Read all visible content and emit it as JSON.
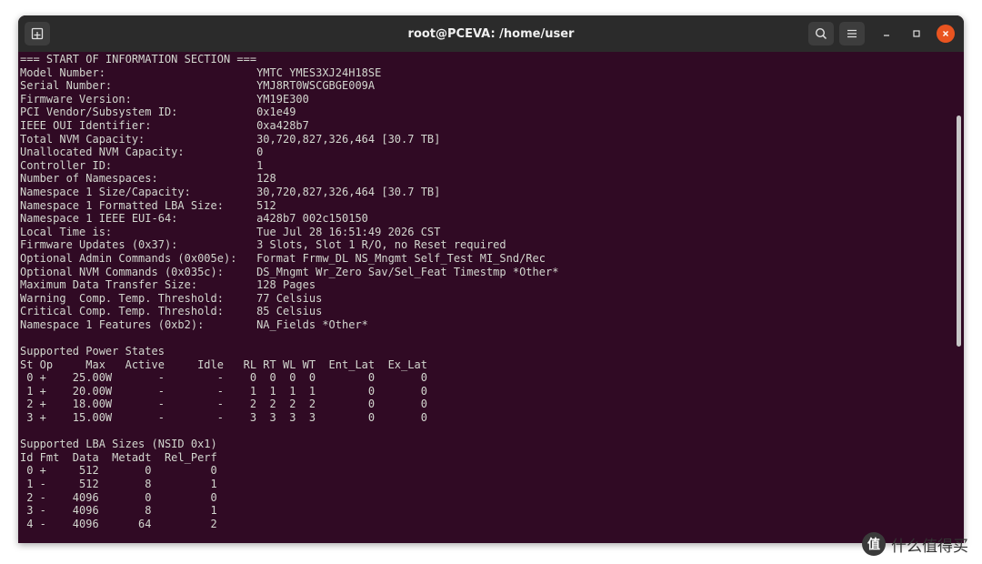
{
  "window": {
    "title": "root@PCEVA: /home/user",
    "colors": {
      "terminal_bg": "#300a24",
      "titlebar_bg": "#2b2b2b",
      "text": "#d3d7cf",
      "close_button": "#e95420"
    },
    "icons": {
      "new_tab": "new-tab-icon",
      "search": "search-icon",
      "menu": "hamburger-menu-icon",
      "minimize": "minimize-icon",
      "maximize": "maximize-icon",
      "close": "close-icon"
    }
  },
  "terminal": {
    "lines": [
      "=== START OF INFORMATION SECTION ===",
      "Model Number:                       YMTC YMES3XJ24H18SE",
      "Serial Number:                      YMJ8RT0WSCGBGE009A",
      "Firmware Version:                   YM19E300",
      "PCI Vendor/Subsystem ID:            0x1e49",
      "IEEE OUI Identifier:                0xa428b7",
      "Total NVM Capacity:                 30,720,827,326,464 [30.7 TB]",
      "Unallocated NVM Capacity:           0",
      "Controller ID:                      1",
      "Number of Namespaces:               128",
      "Namespace 1 Size/Capacity:          30,720,827,326,464 [30.7 TB]",
      "Namespace 1 Formatted LBA Size:     512",
      "Namespace 1 IEEE EUI-64:            a428b7 002c150150",
      "Local Time is:                      Tue Jul 28 16:51:49 2026 CST",
      "Firmware Updates (0x37):            3 Slots, Slot 1 R/O, no Reset required",
      "Optional Admin Commands (0x005e):   Format Frmw_DL NS_Mngmt Self_Test MI_Snd/Rec",
      "Optional NVM Commands (0x035c):     DS_Mngmt Wr_Zero Sav/Sel_Feat Timestmp *Other*",
      "Maximum Data Transfer Size:         128 Pages",
      "Warning  Comp. Temp. Threshold:     77 Celsius",
      "Critical Comp. Temp. Threshold:     85 Celsius",
      "Namespace 1 Features (0xb2):        NA_Fields *Other*",
      "",
      "Supported Power States",
      "St Op     Max   Active     Idle   RL RT WL WT  Ent_Lat  Ex_Lat",
      " 0 +    25.00W       -        -    0  0  0  0        0       0",
      " 1 +    20.00W       -        -    1  1  1  1        0       0",
      " 2 +    18.00W       -        -    2  2  2  2        0       0",
      " 3 +    15.00W       -        -    3  3  3  3        0       0",
      "",
      "Supported LBA Sizes (NSID 0x1)",
      "Id Fmt  Data  Metadt  Rel_Perf",
      " 0 +     512       0         0",
      " 1 -     512       8         1",
      " 2 -    4096       0         0",
      " 3 -    4096       8         1",
      " 4 -    4096      64         2"
    ]
  },
  "watermark": {
    "logo": "值",
    "text": "什么值得买"
  }
}
